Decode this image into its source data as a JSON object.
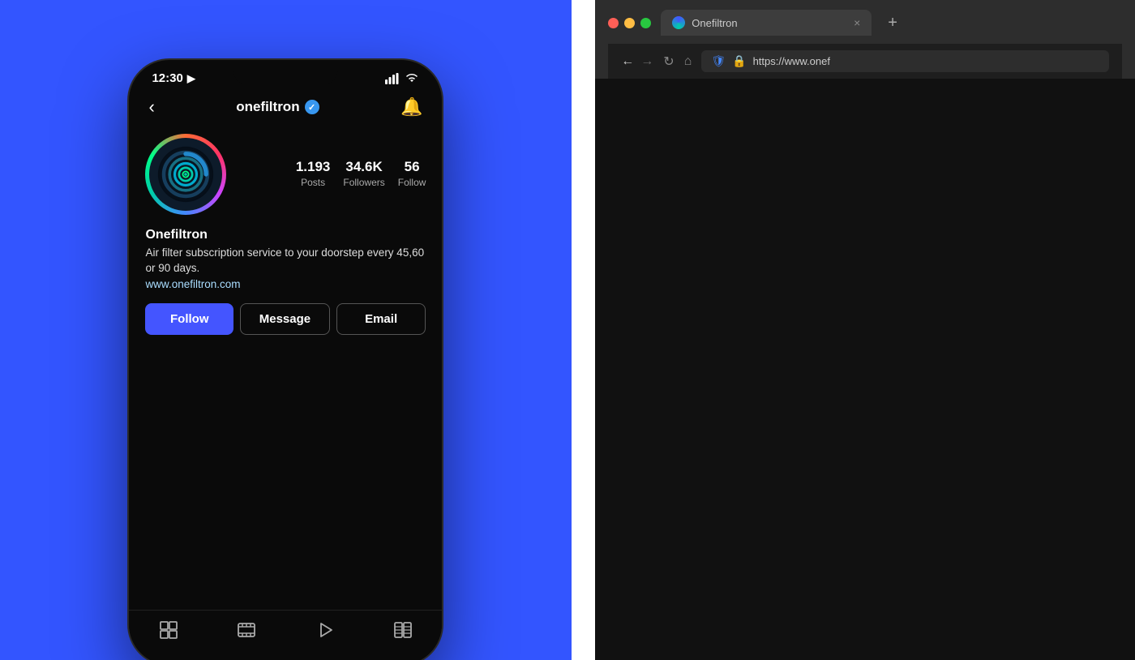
{
  "left": {
    "phone": {
      "status_bar": {
        "time": "12:30",
        "signal_icon": "signal",
        "wifi_icon": "wifi",
        "location_icon": "▶"
      },
      "nav": {
        "back_label": "‹",
        "username": "onefiltron",
        "verified": true,
        "bell_label": "🔔"
      },
      "profile": {
        "stats": [
          {
            "value": "1.193",
            "label": "Posts"
          },
          {
            "value": "34.6K",
            "label": "Followers"
          },
          {
            "value": "56",
            "label": "Follow"
          }
        ]
      },
      "bio": {
        "name": "Onefiltron",
        "description": "Air filter subscription service to your doorstep every 45,60 or 90 days.",
        "website": "www.onefiltron.com"
      },
      "buttons": {
        "follow": "Follow",
        "message": "Message",
        "email": "Email"
      },
      "tabs": [
        "grid",
        "video",
        "play",
        "book"
      ]
    }
  },
  "right": {
    "browser": {
      "tab": {
        "title": "Onefiltron",
        "close": "×"
      },
      "new_tab": "+",
      "addressbar": {
        "back": "←",
        "forward": "→",
        "refresh": "↻",
        "home": "⌂",
        "url": "https://www.onef"
      }
    }
  }
}
